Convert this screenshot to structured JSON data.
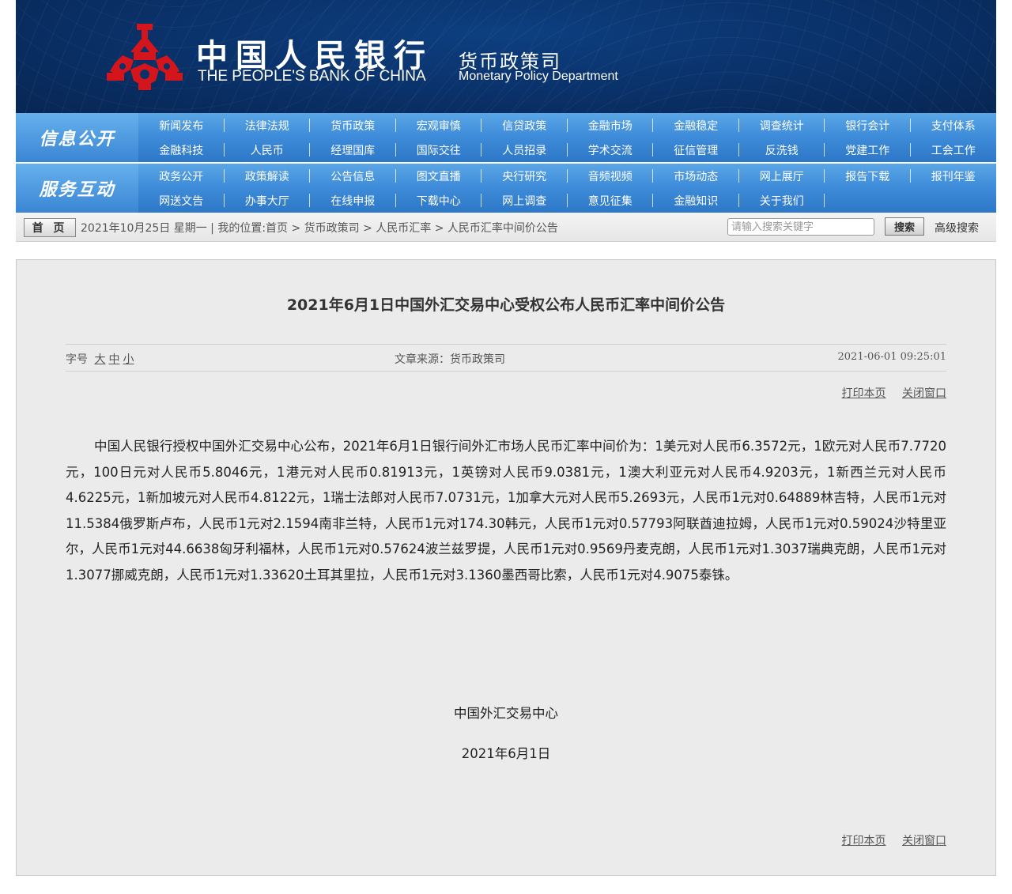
{
  "header": {
    "bank_name_cn": "中国人民银行",
    "bank_name_en": "THE PEOPLE'S BANK OF CHINA",
    "dept_cn": "货币政策司",
    "dept_en": "Monetary Policy Department",
    "colors": {
      "banner": "#0a3169",
      "logo_red": "#d4161c",
      "nav_blue": "#3d8bd9"
    }
  },
  "nav": {
    "group1": {
      "label": "信息公开",
      "items": [
        "新闻发布",
        "法律法规",
        "货币政策",
        "宏观审慎",
        "信贷政策",
        "金融市场",
        "金融稳定",
        "调查统计",
        "银行会计",
        "支付体系",
        "金融科技",
        "人民币",
        "经理国库",
        "国际交往",
        "人员招录",
        "学术交流",
        "征信管理",
        "反洗钱",
        "党建工作",
        "工会工作"
      ]
    },
    "group2": {
      "label": "服务互动",
      "items": [
        "政务公开",
        "政策解读",
        "公告信息",
        "图文直播",
        "央行研究",
        "音频视频",
        "市场动态",
        "网上展厅",
        "报告下载",
        "报刊年鉴",
        "网送文告",
        "办事大厅",
        "在线申报",
        "下载中心",
        "网上调查",
        "意见征集",
        "金融知识",
        "关于我们"
      ]
    }
  },
  "crumb": {
    "home": "首 页",
    "text": "2021年10月25日 星期一 | 我的位置:首页 > 货币政策司 > 人民币汇率 > 人民币汇率中间价公告",
    "search_placeholder": "请输入搜索关键字",
    "search_button": "搜索",
    "advanced_search": "高级搜索"
  },
  "article": {
    "title": "2021年6月1日中国外汇交易中心受权公布人民币汇率中间价公告",
    "font_size_label": "字号",
    "font_sizes": [
      "大",
      "中",
      "小"
    ],
    "source": "文章来源：货币政策司",
    "datetime": "2021-06-01 09:25:01",
    "print": "打印本页",
    "close": "关闭窗口",
    "body": "中国人民银行授权中国外汇交易中心公布，2021年6月1日银行间外汇市场人民币汇率中间价为：1美元对人民币6.3572元，1欧元对人民币7.7720元，100日元对人民币5.8046元，1港元对人民币0.81913元，1英镑对人民币9.0381元，1澳大利亚元对人民币4.9203元，1新西兰元对人民币4.6225元，1新加坡元对人民币4.8122元，1瑞士法郎对人民币7.0731元，1加拿大元对人民币5.2693元，人民币1元对0.64889林吉特，人民币1元对11.5384俄罗斯卢布，人民币1元对2.1594南非兰特，人民币1元对174.30韩元，人民币1元对0.57793阿联酋迪拉姆，人民币1元对0.59024沙特里亚尔，人民币1元对44.6638匈牙利福林，人民币1元对0.57624波兰兹罗提，人民币1元对0.9569丹麦克朗，人民币1元对1.3037瑞典克朗，人民币1元对1.3077挪威克朗，人民币1元对1.33620土耳其里拉，人民币1元对3.1360墨西哥比索，人民币1元对4.9075泰铢。",
    "signer": "中国外汇交易中心",
    "sign_date": "2021年6月1日"
  }
}
